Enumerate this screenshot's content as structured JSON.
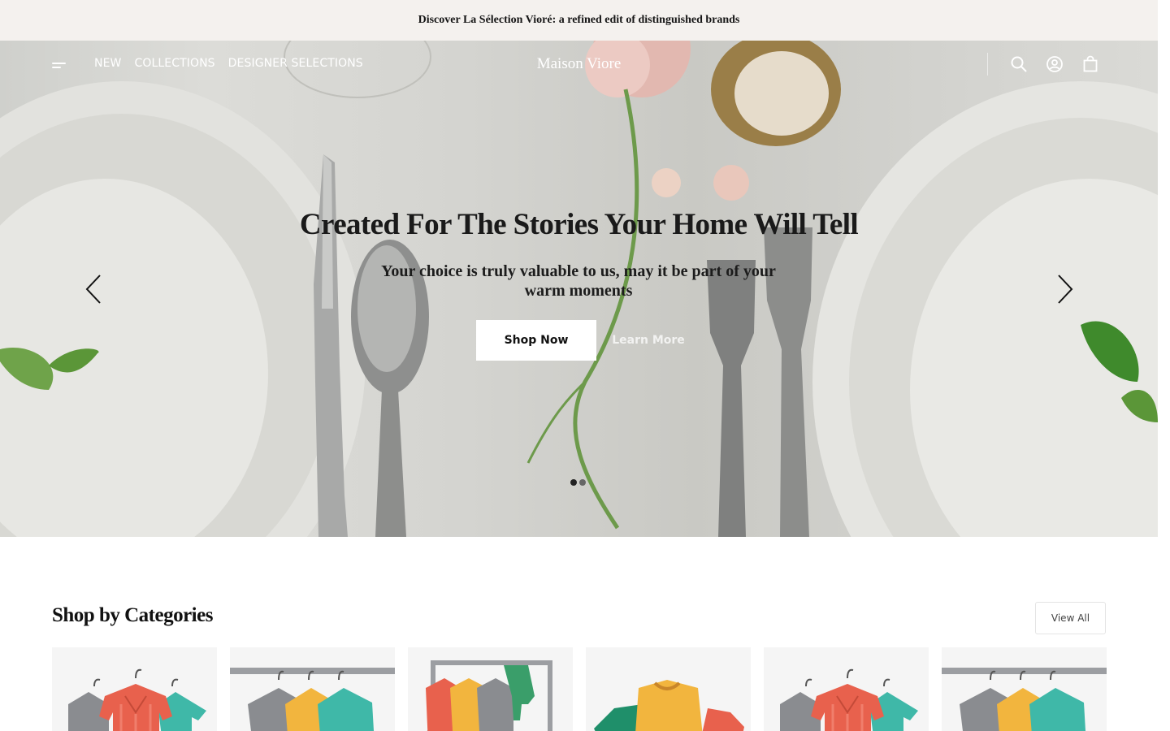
{
  "announcement": {
    "text": "Discover La Sélection Vioré: a refined edit of distinguished brands"
  },
  "header": {
    "brand": "Maison Viore",
    "nav": [
      {
        "label": "NEW"
      },
      {
        "label": "COLLECTIONS"
      },
      {
        "label": "DESIGNER SELECTIONS"
      }
    ],
    "icons": [
      "menu-icon",
      "search-icon",
      "account-icon",
      "bag-icon"
    ]
  },
  "hero": {
    "title": "Created For The Stories Your Home Will Tell",
    "subtitle": "Your choice is truly valuable to us, may it be part of your warm moments",
    "primary_cta": "Shop Now",
    "secondary_cta": "Learn More",
    "slides_count": 2,
    "active_slide": 1
  },
  "categories": {
    "title": "Shop by Categories",
    "view_all": "View All",
    "items": [
      {
        "art": "shirts-hangers"
      },
      {
        "art": "rack-three-shirts"
      },
      {
        "art": "clothes-rack-scarf"
      },
      {
        "art": "folded-tees"
      },
      {
        "art": "shirts-hangers"
      },
      {
        "art": "rack-three-shirts"
      }
    ]
  },
  "colors": {
    "announcement_bg": "#f4f1ee",
    "button_bg": "#ffffff",
    "text": "#111111"
  }
}
